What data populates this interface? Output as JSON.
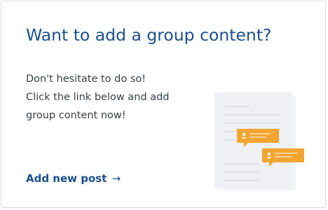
{
  "card": {
    "title": "Want to add a group content?",
    "body_lines": [
      "Don't hesitate to do so!",
      "Click the link below and add",
      "group content now!"
    ],
    "link_label": "Add new post",
    "link_arrow": "→"
  },
  "illustration": {
    "icon": "document-with-comments-icon",
    "accent_color": "#f3a531",
    "paper_color": "#eef0f3"
  }
}
